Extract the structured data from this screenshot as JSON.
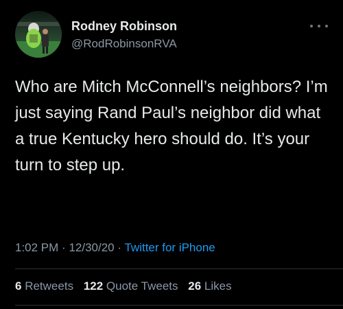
{
  "tweet": {
    "author": {
      "name": "Rodney Robinson",
      "handle": "@RodRobinsonRVA"
    },
    "text": "Who are Mitch McConnell’s neighbors? I’m just saying Rand Paul’s neighbor did what a true Kentucky hero should do. It’s your turn to step up.",
    "time": "1:02 PM",
    "date": "12/30/20",
    "source": "Twitter for iPhone",
    "separator": "·",
    "stats": {
      "retweets_count": "6",
      "retweets_label": "Retweets",
      "quote_tweets_count": "122",
      "quote_tweets_label": "Quote Tweets",
      "likes_count": "26",
      "likes_label": "Likes"
    }
  },
  "icons": {
    "more": "more-horizontal-icon"
  },
  "colors": {
    "background": "#000000",
    "text": "#e7e9ea",
    "secondary": "#8b98a5",
    "link": "#1d9bf0",
    "divider": "#2f3336"
  }
}
